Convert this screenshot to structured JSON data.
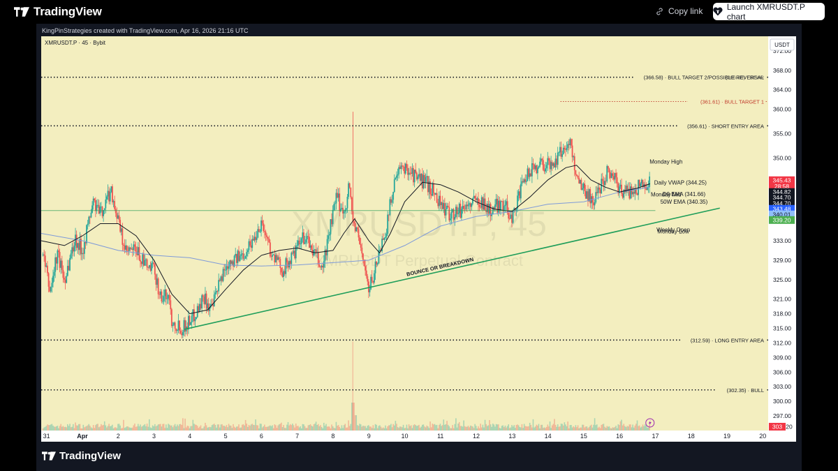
{
  "header": {
    "brand": "TradingView",
    "copy_link": "Copy link",
    "launch_label": "Launch XMRUSDT.P chart"
  },
  "credit": "KingPinStrategies created with TradingView.com, Apr 16, 2026 21:16 UTC",
  "footer_brand": "TradingView",
  "chart_data": {
    "type": "candlestick",
    "symbol_label": "XMRUSDT.P · 45 · Bybit",
    "watermark_symbol": "XMRUSDT.P, 45",
    "watermark_desc": "XMRUSDT Perpetual Contract",
    "currency": "USDT",
    "ylim": [
      294,
      375
    ],
    "y_ticks": [
      297,
      300,
      303,
      306,
      309,
      312,
      315,
      318,
      321,
      325,
      329,
      333,
      337,
      341,
      345,
      350,
      355,
      360,
      364,
      368,
      372
    ],
    "y_tick_labels": [
      "297.00",
      "300.00",
      "303.00",
      "306.00",
      "309.00",
      "312.00",
      "315.00",
      "318.00",
      "321.00",
      "325.00",
      "329.00",
      "333.00",
      "",
      "",
      "",
      "350.00",
      "355.00",
      "360.00",
      "364.00",
      "368.00",
      "372.00"
    ],
    "x_ticks": [
      {
        "label": "31",
        "pos": 0.0
      },
      {
        "label": "Apr",
        "pos": 1.0
      },
      {
        "label": "2",
        "pos": 2.0
      },
      {
        "label": "3",
        "pos": 3.0
      },
      {
        "label": "4",
        "pos": 4.0
      },
      {
        "label": "5",
        "pos": 5.0
      },
      {
        "label": "6",
        "pos": 6.0
      },
      {
        "label": "7",
        "pos": 7.0
      },
      {
        "label": "8",
        "pos": 8.0
      },
      {
        "label": "9",
        "pos": 9.0
      },
      {
        "label": "10",
        "pos": 10.0
      },
      {
        "label": "11",
        "pos": 11.0
      },
      {
        "label": "12",
        "pos": 12.0
      },
      {
        "label": "13",
        "pos": 13.0
      },
      {
        "label": "14",
        "pos": 14.0
      },
      {
        "label": "15",
        "pos": 15.0
      },
      {
        "label": "16",
        "pos": 16.0
      },
      {
        "label": "17",
        "pos": 17.0
      },
      {
        "label": "18",
        "pos": 18.0
      },
      {
        "label": "19",
        "pos": 19.0
      },
      {
        "label": "20",
        "pos": 20.0
      }
    ],
    "x_range": [
      -0.15,
      20.15
    ],
    "price_path": [
      [
        -0.1,
        330.0
      ],
      [
        0.1,
        322.5
      ],
      [
        0.3,
        330.5
      ],
      [
        0.5,
        325.0
      ],
      [
        0.8,
        333.5
      ],
      [
        1.0,
        331.0
      ],
      [
        1.3,
        341.0
      ],
      [
        1.5,
        338.5
      ],
      [
        1.8,
        343.5
      ],
      [
        2.0,
        337.0
      ],
      [
        2.2,
        330.5
      ],
      [
        2.5,
        331.0
      ],
      [
        2.8,
        327.5
      ],
      [
        3.0,
        327.0
      ],
      [
        3.2,
        321.0
      ],
      [
        3.4,
        322.0
      ],
      [
        3.5,
        316.5
      ],
      [
        3.8,
        315.0
      ],
      [
        4.1,
        317.5
      ],
      [
        4.4,
        321.5
      ],
      [
        4.6,
        318.5
      ],
      [
        4.9,
        326.0
      ],
      [
        5.1,
        329.0
      ],
      [
        5.4,
        329.5
      ],
      [
        5.8,
        333.5
      ],
      [
        6.0,
        337.0
      ],
      [
        6.3,
        330.0
      ],
      [
        6.6,
        327.0
      ],
      [
        6.9,
        330.0
      ],
      [
        7.2,
        334.0
      ],
      [
        7.5,
        330.0
      ],
      [
        7.7,
        327.0
      ],
      [
        7.9,
        335.0
      ],
      [
        8.1,
        342.0
      ],
      [
        8.3,
        338.5
      ],
      [
        8.45,
        344.5
      ],
      [
        8.55,
        337.5
      ],
      [
        8.8,
        331.0
      ],
      [
        9.0,
        322.5
      ],
      [
        9.3,
        331.0
      ],
      [
        9.5,
        336.0
      ],
      [
        9.7,
        345.0
      ],
      [
        9.9,
        347.5
      ],
      [
        10.1,
        348.0
      ],
      [
        10.3,
        346.0
      ],
      [
        10.6,
        345.0
      ],
      [
        10.9,
        342.0
      ],
      [
        11.2,
        338.5
      ],
      [
        11.5,
        339.0
      ],
      [
        11.8,
        340.5
      ],
      [
        12.1,
        341.5
      ],
      [
        12.4,
        339.0
      ],
      [
        12.7,
        341.0
      ],
      [
        13.0,
        338.0
      ],
      [
        13.2,
        342.5
      ],
      [
        13.5,
        347.5
      ],
      [
        13.8,
        349.0
      ],
      [
        14.1,
        348.5
      ],
      [
        14.4,
        351.5
      ],
      [
        14.6,
        353.5
      ],
      [
        14.8,
        346.5
      ],
      [
        15.0,
        343.5
      ],
      [
        15.3,
        341.0
      ],
      [
        15.5,
        345.0
      ],
      [
        15.7,
        348.0
      ],
      [
        16.0,
        343.5
      ],
      [
        16.3,
        343.0
      ],
      [
        16.6,
        344.5
      ],
      [
        16.85,
        345.43
      ]
    ],
    "spike": {
      "x": 8.55,
      "high": 359.5,
      "low": 336.0
    },
    "ema_path": [
      [
        -0.15,
        333.0
      ],
      [
        0.5,
        332.0
      ],
      [
        1.0,
        334.0
      ],
      [
        1.5,
        336.5
      ],
      [
        2.0,
        336.5
      ],
      [
        2.5,
        334.0
      ],
      [
        3.0,
        329.0
      ],
      [
        3.5,
        322.0
      ],
      [
        4.0,
        318.0
      ],
      [
        4.5,
        318.8
      ],
      [
        5.0,
        323.0
      ],
      [
        5.5,
        327.0
      ],
      [
        6.0,
        330.0
      ],
      [
        6.5,
        331.0
      ],
      [
        7.0,
        331.5
      ],
      [
        7.5,
        330.5
      ],
      [
        8.0,
        331.0
      ],
      [
        8.3,
        334.5
      ],
      [
        8.6,
        337.5
      ],
      [
        9.0,
        333.0
      ],
      [
        9.3,
        330.5
      ],
      [
        9.6,
        334.5
      ],
      [
        10.0,
        341.0
      ],
      [
        10.5,
        345.0
      ],
      [
        11.0,
        344.5
      ],
      [
        11.5,
        343.0
      ],
      [
        12.0,
        341.0
      ],
      [
        12.5,
        339.5
      ],
      [
        13.0,
        339.0
      ],
      [
        13.5,
        342.0
      ],
      [
        14.0,
        345.5
      ],
      [
        14.5,
        348.0
      ],
      [
        14.8,
        348.5
      ],
      [
        15.2,
        345.5
      ],
      [
        15.6,
        344.0
      ],
      [
        16.0,
        343.0
      ],
      [
        16.5,
        343.8
      ],
      [
        16.85,
        344.7
      ]
    ],
    "vwap50_path": [
      [
        -0.15,
        334.5
      ],
      [
        1.0,
        333.0
      ],
      [
        2.0,
        331.0
      ],
      [
        3.0,
        330.0
      ],
      [
        4.0,
        329.5
      ],
      [
        5.0,
        328.0
      ],
      [
        6.0,
        327.8
      ],
      [
        7.0,
        328.0
      ],
      [
        8.0,
        328.5
      ],
      [
        9.0,
        329.0
      ],
      [
        10.0,
        332.0
      ],
      [
        11.0,
        336.0
      ],
      [
        12.0,
        338.0
      ],
      [
        13.0,
        339.0
      ],
      [
        14.0,
        340.5
      ],
      [
        15.0,
        341.0
      ],
      [
        15.5,
        342.0
      ],
      [
        16.0,
        343.0
      ],
      [
        16.85,
        344.0
      ]
    ],
    "green_hline": {
      "value": 339.2,
      "x_start": -0.15,
      "x_end": 17.0
    },
    "trendline": {
      "from": [
        3.85,
        314.8
      ],
      "to": [
        18.8,
        339.7
      ],
      "label": "BOUNCE OR BREAKDOWN"
    },
    "levels": [
      {
        "value": 376.41,
        "text": "(376.41) · BEST RISK",
        "style": "red",
        "x_start": -0.15
      },
      {
        "value": 366.58,
        "text": "(366.58) · BULL TARGET 2/POSSIBLE REVERSAL",
        "style": "black",
        "x_start": -0.15
      },
      {
        "value": 361.61,
        "text": "(361.61) · BULL TARGET 1",
        "style": "red",
        "x_start": 14.35
      },
      {
        "value": 356.61,
        "text": "(356.61) · SHORT ENTRY AREA",
        "style": "black",
        "x_start": -0.15
      },
      {
        "value": 312.59,
        "text": "(312.59) · LONG ENTRY AREA",
        "style": "black",
        "x_start": -0.15
      },
      {
        "value": 302.35,
        "text": "(302.35) · BULL",
        "style": "black",
        "x_start": -0.15
      }
    ],
    "extra_text": "(366.58) · BEAR",
    "annotations": [
      {
        "text": "Monday High",
        "value": 349.3,
        "x": 17.3
      },
      {
        "text": "Daily VWAP (344.25)",
        "value": 345.0,
        "x": 17.7
      },
      {
        "text": "Monday Mid",
        "value": 342.5,
        "x": 17.3
      },
      {
        "text": "D9 EMA (341.66)",
        "value": 342.6,
        "x": 17.8
      },
      {
        "text": "50W EMA (340.35)",
        "value": 341.0,
        "x": 17.8
      },
      {
        "text": "Weekly Open",
        "value": 335.3,
        "x": 17.5
      },
      {
        "text": "Monday Low",
        "value": 334.9,
        "x": 17.5
      }
    ],
    "price_badges": [
      {
        "text": "345.43",
        "value": 345.43,
        "color": "#f23645"
      },
      {
        "text": "28:58",
        "value": 344.2,
        "color": "#f23645"
      },
      {
        "text": "344.82",
        "value": 343.0,
        "color": "#131722"
      },
      {
        "text": "344.70",
        "value": 341.85,
        "color": "#131722"
      },
      {
        "text": "344.70",
        "value": 340.7,
        "color": "#131722"
      },
      {
        "text": "343.48",
        "value": 339.55,
        "color": "#2962ff"
      },
      {
        "text": "340.01",
        "value": 338.4,
        "color": "#90bff9"
      },
      {
        "text": "339.20",
        "value": 337.25,
        "color": "#4caf50"
      }
    ],
    "volume_badge": "303",
    "volume_badge_suffix": "20",
    "colors": {
      "up": "#26a69a",
      "down": "#ef5350",
      "ema": "#131722",
      "vwap": "#7e9ad9",
      "green": "#2e9e5a",
      "trend": "#1f9e5a",
      "bg": "#f3eebf",
      "axis_bg": "#ffffff"
    }
  }
}
